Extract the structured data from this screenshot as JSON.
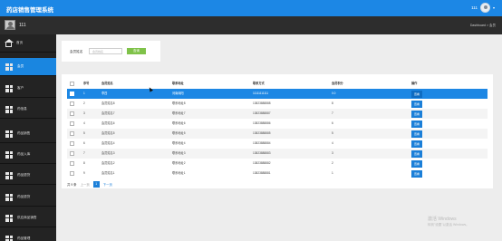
{
  "app": {
    "title": "药店销售管理系统"
  },
  "topbar": {
    "username": "111",
    "caret": "▾"
  },
  "subbar": {
    "username": "111",
    "breadcrumb": "Dashboard > 会员"
  },
  "sidebar": {
    "items": [
      {
        "label": "首页",
        "icon": "home-icon",
        "active": false
      },
      {
        "label": "会员",
        "icon": "grid-icon",
        "active": true
      },
      {
        "label": "客户",
        "icon": "grid-icon",
        "active": false
      },
      {
        "label": "药信息",
        "icon": "grid-icon",
        "active": false
      },
      {
        "label": "药品销售",
        "icon": "grid-icon",
        "active": false
      },
      {
        "label": "药品入库",
        "icon": "grid-icon",
        "active": false
      },
      {
        "label": "药品退货",
        "icon": "grid-icon",
        "active": false
      },
      {
        "label": "药品退货",
        "icon": "grid-icon",
        "active": false
      },
      {
        "label": "供应商品销售",
        "icon": "grid-icon",
        "active": false
      },
      {
        "label": "药品管理",
        "icon": "grid-icon",
        "active": false
      }
    ]
  },
  "search": {
    "label": "会员姓名",
    "placeholder": "会员姓名",
    "value": "",
    "button": "查询"
  },
  "table": {
    "headers": [
      "",
      "序号",
      "会员姓名",
      "联系地址",
      "联系方式",
      "会员积分",
      "操作"
    ],
    "rows": [
      {
        "no": "1",
        "name": "李四",
        "address": "河南南阳",
        "phone": "11111111111",
        "points": "0.0",
        "action": "查看",
        "selected": true
      },
      {
        "no": "2",
        "name": "会员姓名8",
        "address": "联系地址8",
        "phone": "13823888888",
        "points": "8",
        "action": "查看",
        "selected": false
      },
      {
        "no": "3",
        "name": "会员姓名7",
        "address": "联系地址7",
        "phone": "13823888887",
        "points": "7",
        "action": "查看",
        "selected": false
      },
      {
        "no": "4",
        "name": "会员姓名6",
        "address": "联系地址6",
        "phone": "13823888886",
        "points": "6",
        "action": "查看",
        "selected": false
      },
      {
        "no": "5",
        "name": "会员姓名5",
        "address": "联系地址5",
        "phone": "13823888885",
        "points": "5",
        "action": "查看",
        "selected": false
      },
      {
        "no": "6",
        "name": "会员姓名4",
        "address": "联系地址4",
        "phone": "13823888884",
        "points": "4",
        "action": "查看",
        "selected": false
      },
      {
        "no": "7",
        "name": "会员姓名3",
        "address": "联系地址3",
        "phone": "13823888883",
        "points": "3",
        "action": "查看",
        "selected": false
      },
      {
        "no": "8",
        "name": "会员姓名2",
        "address": "联系地址2",
        "phone": "13823888882",
        "points": "2",
        "action": "查看",
        "selected": false
      },
      {
        "no": "9",
        "name": "会员姓名1",
        "address": "联系地址1",
        "phone": "13823888881",
        "points": "1",
        "action": "查看",
        "selected": false
      }
    ]
  },
  "pagination": {
    "total": "共 9 条",
    "prev": "上一页",
    "current": "1",
    "next": "下一页"
  },
  "watermark": {
    "title": "激活 Windows",
    "subtitle": "转到\"设置\"以激活 Windows。"
  },
  "colors": {
    "accent": "#1c87e5",
    "sidebar_bg": "#232323",
    "search_button": "#7fc249"
  }
}
